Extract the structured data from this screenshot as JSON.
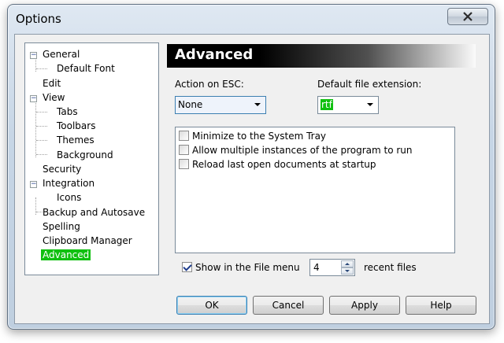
{
  "window": {
    "title": "Options",
    "close_icon": "close-icon"
  },
  "tree": {
    "items": [
      {
        "label": "General",
        "level": 0,
        "expander": "−"
      },
      {
        "label": "Default Font",
        "level": 1
      },
      {
        "label": "Edit",
        "level": 0
      },
      {
        "label": "View",
        "level": 0,
        "expander": "−"
      },
      {
        "label": "Tabs",
        "level": 1
      },
      {
        "label": "Toolbars",
        "level": 1
      },
      {
        "label": "Themes",
        "level": 1
      },
      {
        "label": "Background",
        "level": 1
      },
      {
        "label": "Security",
        "level": 0
      },
      {
        "label": "Integration",
        "level": 0,
        "expander": "−"
      },
      {
        "label": "Icons",
        "level": 1
      },
      {
        "label": "Backup and Autosave",
        "level": 0
      },
      {
        "label": "Spelling",
        "level": 0
      },
      {
        "label": "Clipboard Manager",
        "level": 0
      },
      {
        "label": "Advanced",
        "level": 0,
        "selected": true
      }
    ]
  },
  "panel": {
    "heading": "Advanced",
    "action_on_esc": {
      "label": "Action on ESC:",
      "value": "None"
    },
    "default_ext": {
      "label": "Default file extension:",
      "value": "rtf"
    },
    "options": [
      {
        "label": "Minimize to the System Tray",
        "checked": false
      },
      {
        "label": "Allow multiple instances of the program to run",
        "checked": false
      },
      {
        "label": "Reload last open documents at startup",
        "checked": false
      }
    ],
    "file_menu": {
      "label": "Show in the File menu",
      "checked": true,
      "count": "4",
      "suffix": "recent files"
    }
  },
  "buttons": {
    "ok": "OK",
    "cancel": "Cancel",
    "apply": "Apply",
    "help": "Help"
  },
  "colors": {
    "selection": "#10c010",
    "header_start": "#000000"
  }
}
